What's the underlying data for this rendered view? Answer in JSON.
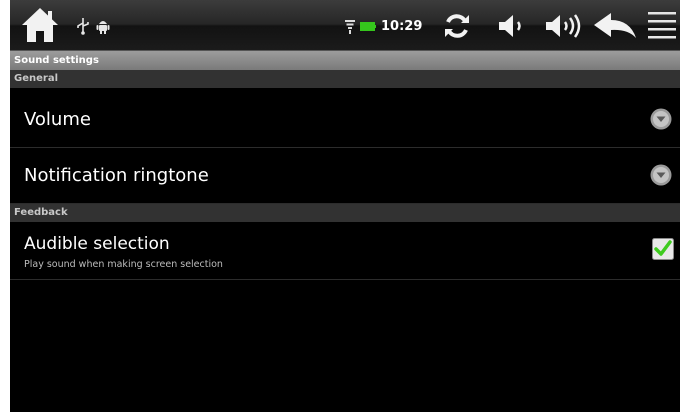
{
  "status_bar": {
    "time": "10:29",
    "icons": [
      "home-icon",
      "usb-icon",
      "android-debug-icon",
      "wifi-icon",
      "battery-icon",
      "refresh-icon",
      "volume-down-icon",
      "volume-up-icon",
      "back-arrow-icon",
      "menu-icon"
    ]
  },
  "title": "Sound settings",
  "categories": {
    "general": "General",
    "feedback": "Feedback"
  },
  "preferences": [
    {
      "title": "Volume",
      "summary": "",
      "widget": "dropdown"
    },
    {
      "title": "Notification ringtone",
      "summary": "",
      "widget": "dropdown"
    },
    {
      "title": "Audible selection",
      "summary": "Play sound when making screen selection",
      "widget": "checkbox",
      "checked": true
    }
  ],
  "colors": {
    "background": "#000000",
    "title_bar": "#8a8a8a",
    "category_bar": "#323232",
    "checkmark": "#3ecb1e"
  }
}
